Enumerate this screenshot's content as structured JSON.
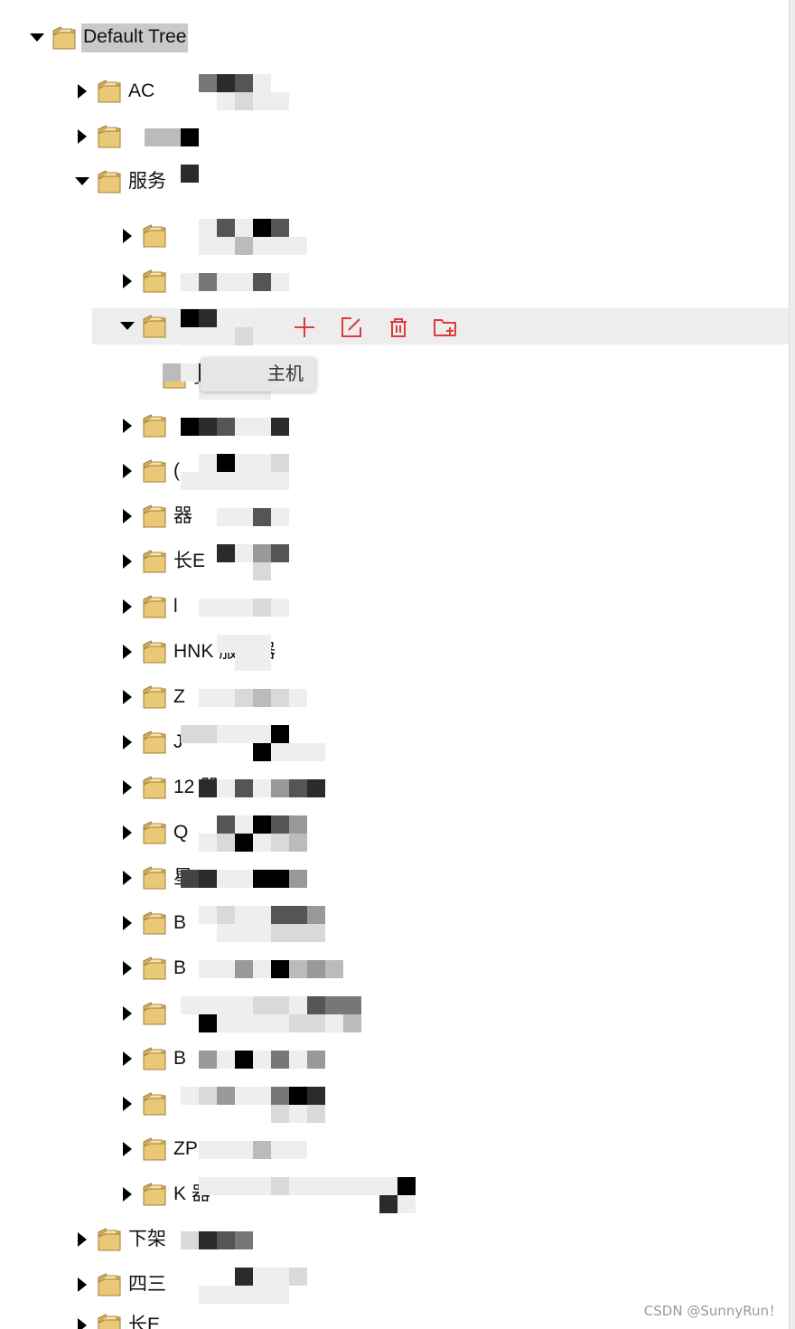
{
  "root": {
    "label": "Default Tree"
  },
  "level1_top": [
    {
      "label": "AC"
    },
    {
      "label": ""
    },
    {
      "label": "服务"
    }
  ],
  "level2": [
    {
      "label": ""
    },
    {
      "label": ""
    },
    {
      "label": ""
    },
    {
      "label": ""
    },
    {
      "label": "("
    },
    {
      "label": "器"
    },
    {
      "label": "长E"
    },
    {
      "label": "l"
    },
    {
      "label": "HNK 服务器"
    },
    {
      "label": "Z"
    },
    {
      "label": "J"
    },
    {
      "label": "12 器"
    },
    {
      "label": "Q"
    },
    {
      "label": "星"
    },
    {
      "label": "B"
    },
    {
      "label": "B"
    },
    {
      "label": ""
    },
    {
      "label": "B"
    },
    {
      "label": ""
    },
    {
      "label": "ZP"
    },
    {
      "label": "K 器"
    }
  ],
  "level3_child": {
    "label": "变"
  },
  "level1_bottom": [
    {
      "label": "下架"
    },
    {
      "label": "四三"
    },
    {
      "label": "长E"
    }
  ],
  "tooltip": {
    "text": "主机"
  },
  "actions": [
    {
      "icon": "plus-icon"
    },
    {
      "icon": "edit-icon"
    },
    {
      "icon": "trash-icon"
    },
    {
      "icon": "folder-add-icon"
    }
  ],
  "colors": {
    "action_red": "#e0393e",
    "highlight_bg": "#ededed",
    "root_label_bg": "#c9c9c9"
  },
  "watermark": "CSDN @SunnyRun！"
}
